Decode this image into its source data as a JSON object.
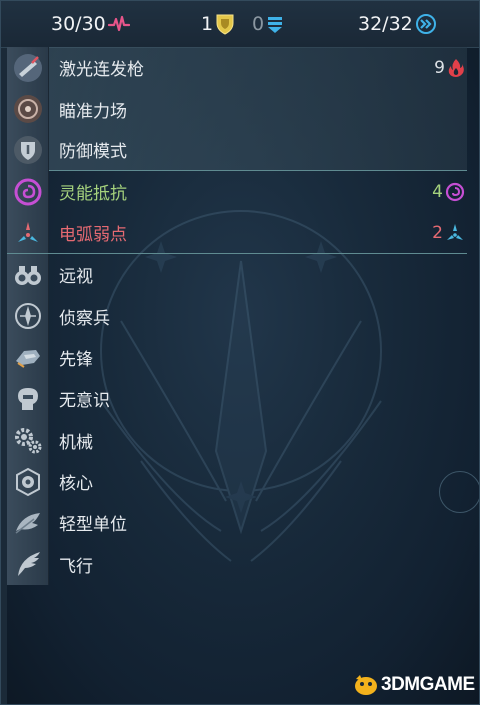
{
  "header": {
    "hp": "30/30",
    "armor": "1",
    "shield": "0",
    "movement": "32/32"
  },
  "traits": [
    {
      "label": "激光连发枪",
      "count": "9",
      "icon": "laser-gun-icon",
      "count_icon": "fire-icon",
      "color": "#e6eaee"
    },
    {
      "label": "瞄准力场",
      "icon": "targeting-field-icon"
    },
    {
      "label": "防御模式",
      "icon": "defense-mode-icon"
    },
    {
      "label": "灵能抵抗",
      "count": "4",
      "icon": "psionic-icon",
      "count_icon": "psionic-swirl-icon",
      "color": "#a5d27d"
    },
    {
      "label": "电弧弱点",
      "count": "2",
      "icon": "arc-icon",
      "count_icon": "arc-weakness-icon",
      "color": "#e56a72"
    },
    {
      "label": "远视",
      "icon": "binoculars-icon"
    },
    {
      "label": "侦察兵",
      "icon": "scout-icon"
    },
    {
      "label": "先锋",
      "icon": "vanguard-icon"
    },
    {
      "label": "无意识",
      "icon": "mindless-icon"
    },
    {
      "label": "机械",
      "icon": "gears-icon"
    },
    {
      "label": "核心",
      "icon": "core-icon"
    },
    {
      "label": "轻型单位",
      "icon": "feather-icon"
    },
    {
      "label": "飞行",
      "icon": "wing-icon"
    }
  ],
  "watermark": "3DMGAME",
  "colors": {
    "health": "#e7558a",
    "armor": "#e3c74a",
    "shield": "#3fb2e8",
    "movement": "#3fb2e8",
    "fire": "#e1404a",
    "psionic": "#c64fd4",
    "arc": "#4ab8e0"
  }
}
